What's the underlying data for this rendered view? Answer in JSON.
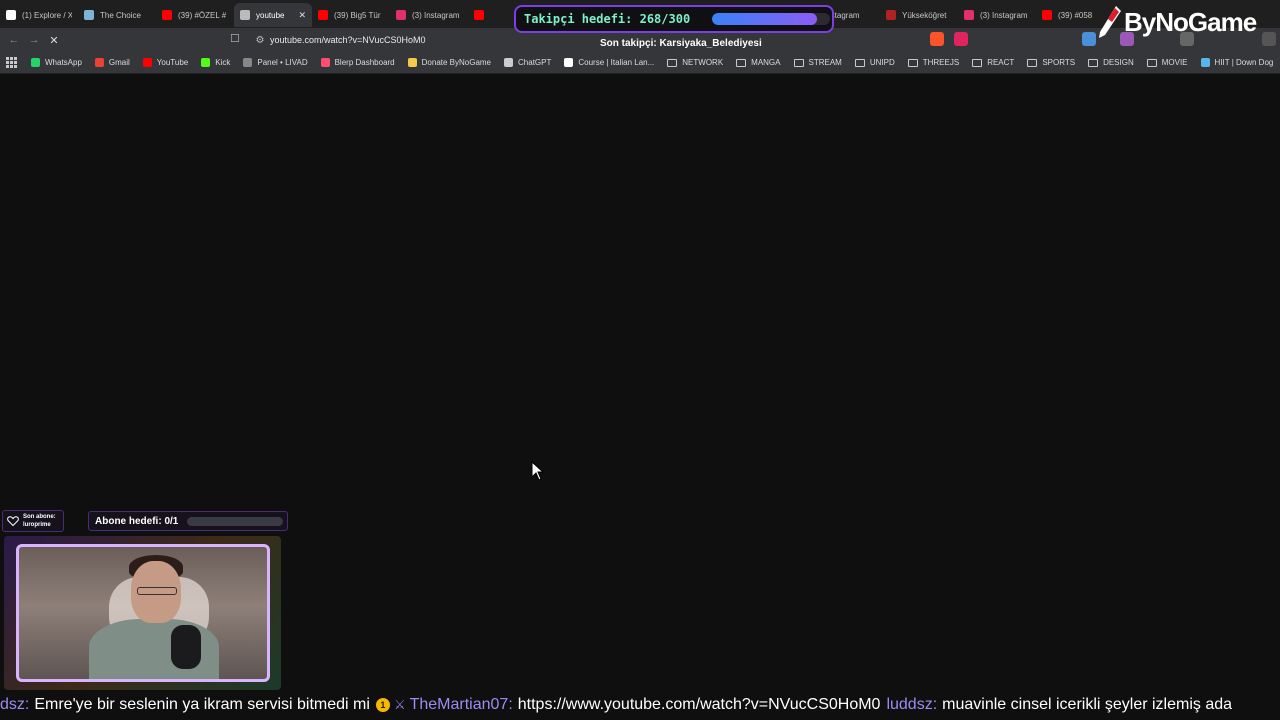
{
  "tabs": [
    {
      "title": "(1) Explore / X",
      "icon": "x-icon",
      "color": "#ffffff"
    },
    {
      "title": "The Choice",
      "icon": "bookmark-icon",
      "color": "#7fb3d5"
    },
    {
      "title": "(39) #ÖZEL #",
      "icon": "youtube-icon",
      "color": "#ff0000"
    },
    {
      "title": "youtube",
      "icon": "loading-icon",
      "color": "#bbbbbb",
      "active": true
    },
    {
      "title": "(39) Big5 Tür",
      "icon": "youtube-icon",
      "color": "#ff0000"
    },
    {
      "title": "(3) Instagram",
      "icon": "instagram-icon",
      "color": "#e1306c"
    },
    {
      "title": "(3",
      "icon": "youtube-icon",
      "color": "#ff0000"
    },
    {
      "title": "Instagram",
      "icon": "instagram-icon",
      "color": "#e1306c"
    },
    {
      "title": "Yükseköğret",
      "icon": "yok-icon",
      "color": "#b22222"
    },
    {
      "title": "(3) Instagram",
      "icon": "instagram-icon",
      "color": "#e1306c"
    },
    {
      "title": "(39) #058",
      "icon": "youtube-icon",
      "color": "#ff0000"
    }
  ],
  "address": {
    "url": "youtube.com/watch?v=NVucCS0HoM0"
  },
  "bookmarks": [
    {
      "label": "WhatsApp",
      "icon": "whatsapp-icon",
      "color": "#25d366",
      "type": "site"
    },
    {
      "label": "Gmail",
      "icon": "gmail-icon",
      "color": "#ea4335",
      "type": "site"
    },
    {
      "label": "YouTube",
      "icon": "youtube-icon",
      "color": "#ff0000",
      "type": "site"
    },
    {
      "label": "Kick",
      "icon": "kick-icon",
      "color": "#53fc18",
      "type": "site"
    },
    {
      "label": "Panel • LIVAD",
      "icon": "livad-icon",
      "color": "#888888",
      "type": "site"
    },
    {
      "label": "Blerp Dashboard",
      "icon": "blerp-icon",
      "color": "#ff4d6d",
      "type": "site"
    },
    {
      "label": "Donate ByNoGame",
      "icon": "donate-icon",
      "color": "#f2c94c",
      "type": "site"
    },
    {
      "label": "ChatGPT",
      "icon": "chatgpt-icon",
      "color": "#cccccc",
      "type": "site"
    },
    {
      "label": "Course | Italian Lan...",
      "icon": "x-icon",
      "color": "#ffffff",
      "type": "site"
    },
    {
      "label": "NETWORK",
      "type": "folder"
    },
    {
      "label": "MANGA",
      "type": "folder"
    },
    {
      "label": "STREAM",
      "type": "folder"
    },
    {
      "label": "UNIPD",
      "type": "folder"
    },
    {
      "label": "THREEJS",
      "type": "folder"
    },
    {
      "label": "REACT",
      "type": "folder"
    },
    {
      "label": "SPORTS",
      "type": "folder"
    },
    {
      "label": "DESIGN",
      "type": "folder"
    },
    {
      "label": "MOVIE",
      "type": "folder"
    },
    {
      "label": "HIIT | Down Dog",
      "icon": "downdog-icon",
      "color": "#5ab4f0",
      "type": "site"
    }
  ],
  "overlay": {
    "follower_goal_label": "Takipçi hedefi: 268/300",
    "follower_progress": 0.893,
    "last_follower": "Son takipçi: Karsiyaka_Belediyesi",
    "logo_text": "ByNoGame",
    "last_sub_title": "Son abone:",
    "last_sub_name": "luroprime",
    "sub_goal_label": "Abone hedefi: 0/1",
    "sub_progress": 0.0
  },
  "chat": [
    {
      "user": "dsz:",
      "message": "Emre'ye bir seslenin ya ikram servisi bitmedi mi"
    },
    {
      "badge": "1",
      "user": "TheMartian07:",
      "message": "https://www.youtube.com/watch?v=NVucCS0HoM0"
    },
    {
      "user": "luddsz:",
      "message": "muavinle cinsel icerikli şeyler izlemiş ada"
    }
  ],
  "colors": {
    "accent": "#8b5cf6",
    "page_bg": "#0f0f0f",
    "goal_text": "#7ef0c8"
  }
}
